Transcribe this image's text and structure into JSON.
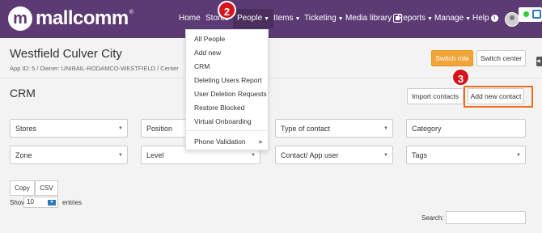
{
  "brand": {
    "logo_letter": "m",
    "name": "mallcomm",
    "reg": "®"
  },
  "nav": {
    "home": "Home",
    "stores": "Stores",
    "people": "People",
    "items": "Items",
    "ticketing": "Ticketing",
    "media_library": "Media library",
    "reports": "Reports",
    "manage": "Manage",
    "help": "Help",
    "help_icon": "i"
  },
  "badges": {
    "step2": "2",
    "step3": "3"
  },
  "page": {
    "title": "Westfield Culver City",
    "subline": "App ID: 5  /  Owner: UNIBAIL-RODAMCO-WESTFIELD  /  Center",
    "switch_role": "Switch role",
    "switch_center": "Switch center",
    "side_tab": "◀"
  },
  "crm": {
    "title": "CRM",
    "import_contacts": "Import contacts",
    "add_new_contact": "Add new contact"
  },
  "filters": {
    "stores": "Stores",
    "position": "Position",
    "type_of_contact": "Type of contact",
    "category": "Category",
    "zone": "Zone",
    "level": "Level",
    "contact_app_user": "Contact/ App user",
    "tags": "Tags"
  },
  "table": {
    "copy": "Copy",
    "csv": "CSV",
    "show": "Show",
    "show_value": "10",
    "entries": "entries",
    "search": "Search:"
  },
  "dropdown": {
    "items": [
      "All People",
      "Add new",
      "CRM",
      "Deleting Users Report",
      "User Deletion Requests",
      "Restore Blocked",
      "Virtual Onboarding"
    ],
    "phone_validation": "Phone Validation"
  },
  "colors": {
    "nav_bg": "#5c3b74",
    "accent_orange": "#f0a43a",
    "highlight": "#ef6c1a",
    "badge_red": "#d6141e",
    "status_green": "#2ecc40"
  }
}
